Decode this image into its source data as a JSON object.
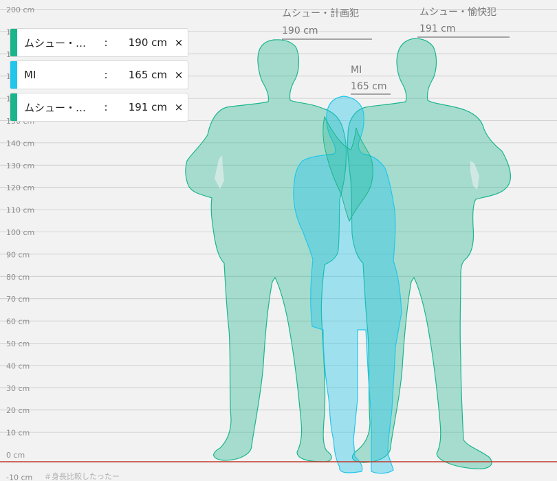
{
  "chart_data": {
    "type": "height-comparison",
    "unit": "cm",
    "ylim": [
      -10,
      200
    ],
    "tick_step": 10,
    "grid": true,
    "ground_line_color": "#c0392b",
    "series": [
      {
        "name": "ムシュー・計画犯",
        "height": 190,
        "color": "#1ab58c"
      },
      {
        "name": "MI",
        "height": 165,
        "color": "#22c6ea"
      },
      {
        "name": "ムシュー・愉快犯",
        "height": 191,
        "color": "#1ab58c"
      }
    ]
  },
  "legend": [
    {
      "name": "ムシュー・…",
      "colon": ":",
      "height": "190 cm",
      "remove_icon": "×",
      "color": "#1ab58c"
    },
    {
      "name": "MI",
      "colon": ":",
      "height": "165 cm",
      "remove_icon": "×",
      "color": "#22c6ea"
    },
    {
      "name": "ムシュー・…",
      "colon": ":",
      "height": "191 cm",
      "remove_icon": "×",
      "color": "#1ab58c"
    }
  ],
  "labels": [
    {
      "name": "ムシュー・計画犯",
      "height": "190 cm"
    },
    {
      "name": "MI",
      "height": "165 cm"
    },
    {
      "name": "ムシュー・愉快犯",
      "height": "191 cm"
    }
  ],
  "footer_tag": "＃身長比較したったー"
}
